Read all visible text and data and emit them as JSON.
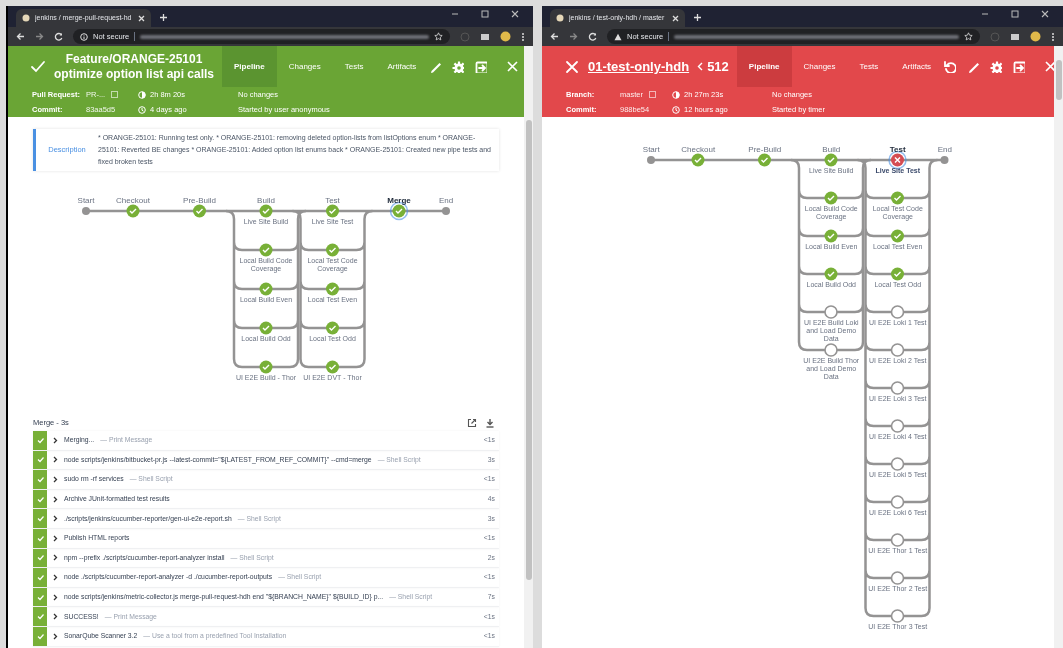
{
  "windows": [
    {
      "browser": {
        "tab_title": "jenkins / merge-pull-request-hd",
        "security": "Not secure"
      },
      "header": {
        "kind": "success",
        "title_lines": [
          "Feature/ORANGE-25101",
          "optimize option list api calls"
        ],
        "replay_available": false,
        "tabs": [
          {
            "label": "Pipeline",
            "selected": true
          },
          {
            "label": "Changes",
            "selected": false
          },
          {
            "label": "Tests",
            "selected": false
          },
          {
            "label": "Artifacts",
            "selected": false
          }
        ],
        "meta": {
          "primary": [
            {
              "label": "Pull Request:",
              "value": "PR-...",
              "link": true
            },
            {
              "label": "Commit:",
              "value": "83aa5d5",
              "link": false
            }
          ],
          "duration": "2h 8m 20s",
          "started_ago": "4 days ago",
          "changes": "No changes",
          "cause": "Started by user anonymous"
        }
      },
      "description": {
        "label": "Description",
        "text": "* ORANGE-25101: Running test only. * ORANGE-25101: removing deleted option-lists from listOptions enum * ORANGE-25101: Reverted BE changes * ORANGE-25101: Added option list enums back * ORANGE-25101: Created new pipe tests and fixed broken tests"
      },
      "pipeline": {
        "stages": [
          {
            "label": "Start",
            "kind": "terminal",
            "selected": false
          },
          {
            "label": "Checkout",
            "kind": "success",
            "selected": false
          },
          {
            "label": "Pre-Build",
            "kind": "success",
            "selected": false
          },
          {
            "label": "Build",
            "kind": "parallel",
            "selected": false,
            "branches": [
              {
                "label": "Live Site Build",
                "kind": "success"
              },
              {
                "label": "Local Build Code Coverage",
                "kind": "success"
              },
              {
                "label": "Local Build Even",
                "kind": "success"
              },
              {
                "label": "Local Build Odd",
                "kind": "success"
              },
              {
                "label": "UI E2E Build - Thor",
                "kind": "success"
              }
            ]
          },
          {
            "label": "Test",
            "kind": "parallel",
            "selected": false,
            "branches": [
              {
                "label": "Live Site Test",
                "kind": "success"
              },
              {
                "label": "Local Test Code Coverage",
                "kind": "success"
              },
              {
                "label": "Local Test Even",
                "kind": "success"
              },
              {
                "label": "Local Test Odd",
                "kind": "success"
              },
              {
                "label": "UI E2E DVT - Thor",
                "kind": "success"
              }
            ]
          },
          {
            "label": "Merge",
            "kind": "success",
            "selected": true
          },
          {
            "label": "End",
            "kind": "terminal",
            "selected": false
          }
        ]
      },
      "log": {
        "title": "Merge - 3s",
        "steps": [
          {
            "kind": "success",
            "text": "Merging...",
            "type": "— Print Message",
            "duration": "<1s"
          },
          {
            "kind": "success",
            "text": "node scripts/jenkins/bitbucket-pr.js --latest-commit=\"${LATEST_FROM_REF_COMMIT}\" --cmd=merge",
            "type": "— Shell Script",
            "duration": "3s"
          },
          {
            "kind": "success",
            "text": "sudo rm -rf services",
            "type": "— Shell Script",
            "duration": "<1s"
          },
          {
            "kind": "success",
            "text": "Archive JUnit-formatted test results",
            "duration": "4s"
          },
          {
            "kind": "success",
            "text": "./scripts/jenkins/cucumber-reporter/gen-ui-e2e-report.sh",
            "type": "— Shell Script",
            "duration": "3s"
          },
          {
            "kind": "success",
            "text": "Publish HTML reports",
            "duration": "<1s"
          },
          {
            "kind": "success",
            "text": "npm --prefix ./scripts/cucumber-report-analyzer install",
            "type": "— Shell Script",
            "duration": "2s"
          },
          {
            "kind": "success",
            "text": "node ./scripts/cucumber-report-analyzer -d ./cucumber-report-outputs",
            "type": "— Shell Script",
            "duration": "<1s"
          },
          {
            "kind": "success",
            "text": "node scripts/jenkins/metric-collector.js merge-pull-request-hdh end \"${BRANCH_NAME}\" ${BUILD_ID} p...",
            "type": "— Shell Script",
            "duration": "7s"
          },
          {
            "kind": "success",
            "text": "SUCCESS!",
            "type": "— Print Message",
            "duration": "<1s"
          },
          {
            "kind": "success",
            "text": "SonarQube Scanner 3.2",
            "type": "— Use a tool from a predefined Tool Installation",
            "duration": "<1s"
          }
        ]
      }
    },
    {
      "browser": {
        "tab_title": "jenkins / test-only-hdh / master",
        "security": "Not secure"
      },
      "header": {
        "kind": "failed",
        "job_link": "01-test-only-hdh",
        "run_number": "512",
        "replay_available": true,
        "tabs": [
          {
            "label": "Pipeline",
            "selected": true
          },
          {
            "label": "Changes",
            "selected": false
          },
          {
            "label": "Tests",
            "selected": false
          },
          {
            "label": "Artifacts",
            "selected": false
          }
        ],
        "meta": {
          "primary": [
            {
              "label": "Branch:",
              "value": "master",
              "link": true
            },
            {
              "label": "Commit:",
              "value": "988be54",
              "link": false
            }
          ],
          "duration": "2h 27m 23s",
          "started_ago": "12 hours ago",
          "changes": "No changes",
          "cause": "Started by timer"
        }
      },
      "pipeline": {
        "stages": [
          {
            "label": "Start",
            "kind": "terminal",
            "selected": false
          },
          {
            "label": "Checkout",
            "kind": "success",
            "selected": false
          },
          {
            "label": "Pre-Build",
            "kind": "success",
            "selected": false
          },
          {
            "label": "Build",
            "kind": "parallel",
            "selected": false,
            "branches": [
              {
                "label": "Live Site Build",
                "kind": "success"
              },
              {
                "label": "Local Build Code Coverage",
                "kind": "success"
              },
              {
                "label": "Local Build Even",
                "kind": "success"
              },
              {
                "label": "Local Build Odd",
                "kind": "success"
              },
              {
                "label": "UI E2E Build Loki and Load Demo Data",
                "kind": "not_built"
              },
              {
                "label": "UI E2E Build Thor and Load Demo Data",
                "kind": "not_built"
              }
            ]
          },
          {
            "label": "Test",
            "kind": "parallel",
            "selected": true,
            "branches": [
              {
                "label": "Live Site Test",
                "kind": "failed"
              },
              {
                "label": "Local Test Code Coverage",
                "kind": "success"
              },
              {
                "label": "Local Test Even",
                "kind": "success"
              },
              {
                "label": "Local Test Odd",
                "kind": "success"
              },
              {
                "label": "UI E2E Loki 1 Test",
                "kind": "not_built"
              },
              {
                "label": "UI E2E Loki 2 Test",
                "kind": "not_built"
              },
              {
                "label": "UI E2E Loki 3 Test",
                "kind": "not_built"
              },
              {
                "label": "UI E2E Loki 4 Test",
                "kind": "not_built"
              },
              {
                "label": "UI E2E Loki 5 Test",
                "kind": "not_built"
              },
              {
                "label": "UI E2E Loki 6 Test",
                "kind": "not_built"
              },
              {
                "label": "UI E2E Thor 1 Test",
                "kind": "not_built"
              },
              {
                "label": "UI E2E Thor 2 Test",
                "kind": "not_built"
              },
              {
                "label": "UI E2E Thor 3 Test",
                "kind": "not_built"
              }
            ]
          },
          {
            "label": "End",
            "kind": "terminal",
            "selected": false
          }
        ]
      }
    }
  ]
}
